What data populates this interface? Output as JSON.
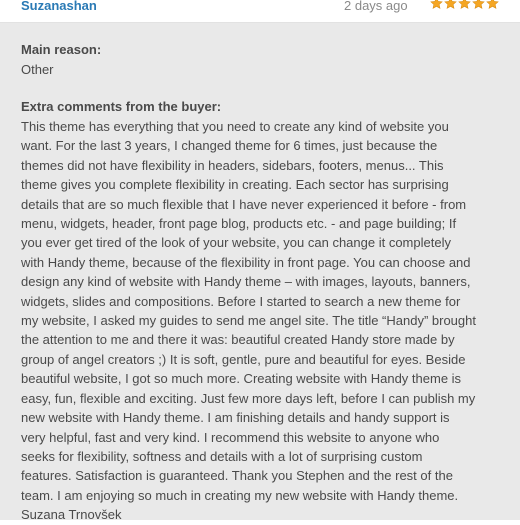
{
  "review": {
    "author": "Suzanashan",
    "date": "2 days ago",
    "rating": 5,
    "star_color": "#f5a623",
    "main_reason_label": "Main reason:",
    "main_reason_value": "Other",
    "extra_label": "Extra comments from the buyer:",
    "comment": "This theme has everything that you need to create any kind of website you want. For the last 3 years, I changed theme for 6 times, just because the themes did not have flexibility in headers, sidebars, footers, menus... This theme gives you complete flexibility in creating. Each sector has surprising details that are so much flexible that I have never experienced it before - from menu, widgets, header, front page blog, products etc. - and page building; If you ever get tired of the look of your website, you can change it completely with Handy theme, because of the flexibility in front page. You can choose and design any kind of website with Handy theme – with images, layouts, banners, widgets, slides and compositions. Before I started to search a new theme for my website, I asked my guides to send me angel site. The title “Handy” brought the attention to me and there it was: beautiful created Handy store made by group of angel creators ;) It is soft, gentle, pure and beautiful for eyes. Beside beautiful website, I got so much more. Creating website with Handy theme is easy, fun, flexible and exciting. Just few more days left, before I can publish my new website with Handy theme. I am finishing details and handy support is very helpful, fast and very kind. I recommend this website to anyone who seeks for flexibility, softness and details with a lot of surprising custom features. Satisfaction is guaranteed. Thank you Stephen and the rest of the team. I am enjoying so much in creating my new website with Handy theme. Suzana Trnovšek"
  }
}
